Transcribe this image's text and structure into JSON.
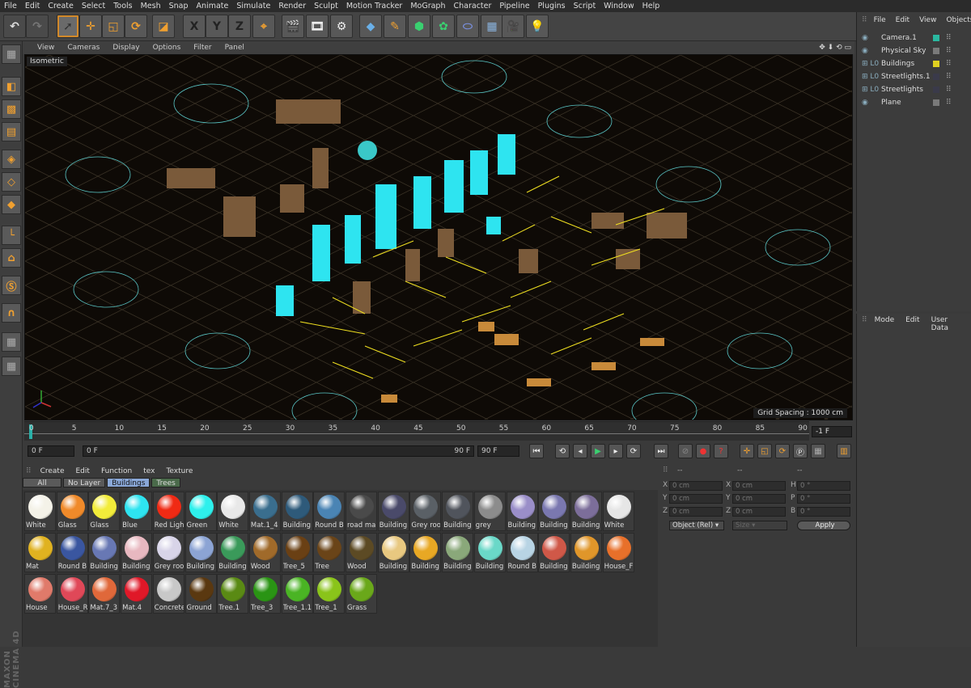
{
  "menu": [
    "File",
    "Edit",
    "Create",
    "Select",
    "Tools",
    "Mesh",
    "Snap",
    "Animate",
    "Simulate",
    "Render",
    "Sculpt",
    "Motion Tracker",
    "MoGraph",
    "Character",
    "Pipeline",
    "Plugins",
    "Script",
    "Window",
    "Help"
  ],
  "axis_buttons": [
    "X",
    "Y",
    "Z"
  ],
  "viewport": {
    "menu": [
      "View",
      "Cameras",
      "Display",
      "Options",
      "Filter",
      "Panel"
    ],
    "label": "Isometric",
    "grid_spacing": "Grid Spacing : 1000 cm"
  },
  "timeline": {
    "ticks": [
      "0",
      "5",
      "10",
      "15",
      "20",
      "25",
      "30",
      "35",
      "40",
      "45",
      "50",
      "55",
      "60",
      "65",
      "70",
      "75",
      "80",
      "85",
      "90"
    ],
    "current_frame": "-1 F",
    "start_field": "0 F",
    "range_start": "0 F",
    "range_end": "90 F",
    "end_field": "90 F"
  },
  "material_manager": {
    "menu": [
      "Create",
      "Edit",
      "Function",
      "tex",
      "Texture"
    ],
    "filters": [
      "All",
      "No Layer",
      "Buildings",
      "Trees"
    ],
    "active_filter": "Buildings",
    "materials": [
      {
        "name": "White",
        "color": "#f4f2e8"
      },
      {
        "name": "Glass",
        "color": "#f08a2a"
      },
      {
        "name": "Glass",
        "color": "#f2ec3a"
      },
      {
        "name": "Blue",
        "color": "#2ee4f0"
      },
      {
        "name": "Red Ligh",
        "color": "#f02a14"
      },
      {
        "name": "Green",
        "color": "#2ef0ec"
      },
      {
        "name": "White",
        "color": "#e8e8e8"
      },
      {
        "name": "Mat.1_4",
        "color": "#3a6e8e"
      },
      {
        "name": "Building",
        "color": "#2e5a7a"
      },
      {
        "name": "Round B",
        "color": "#4a84b4"
      },
      {
        "name": "road ma",
        "color": "#4a4a4a"
      },
      {
        "name": "Building",
        "color": "#4a4a6a"
      },
      {
        "name": "Grey roo",
        "color": "#5a6066"
      },
      {
        "name": "Building",
        "color": "#50545c"
      },
      {
        "name": "grey",
        "color": "#8c8c8c"
      },
      {
        "name": "Building",
        "color": "#9a8ec8"
      },
      {
        "name": "Building",
        "color": "#7a78b0"
      },
      {
        "name": "Building",
        "color": "#7c6e9a"
      },
      {
        "name": "White",
        "color": "#e6e6e6"
      },
      {
        "name": "Mat",
        "color": "#e0b220"
      },
      {
        "name": "Round B",
        "color": "#3a56a0"
      },
      {
        "name": "Building",
        "color": "#6878b4"
      },
      {
        "name": "Building",
        "color": "#e8b8c0"
      },
      {
        "name": "Grey roo",
        "color": "#d8d4e8"
      },
      {
        "name": "Building",
        "color": "#8ca4d4"
      },
      {
        "name": "Building",
        "color": "#3a9a5a"
      },
      {
        "name": "Wood",
        "color": "#a06a2a"
      },
      {
        "name": "Tree_5",
        "color": "#6a4014"
      },
      {
        "name": "Tree",
        "color": "#6a4418"
      },
      {
        "name": "Wood",
        "color": "#5c4a24"
      },
      {
        "name": "Building",
        "color": "#e8c880"
      },
      {
        "name": "Building",
        "color": "#e8a824"
      },
      {
        "name": "Building",
        "color": "#8aa87a"
      },
      {
        "name": "Building",
        "color": "#6ad8c8"
      },
      {
        "name": "Round B",
        "color": "#b8d4e4"
      },
      {
        "name": "Building",
        "color": "#d05848"
      },
      {
        "name": "Building",
        "color": "#e0962a"
      },
      {
        "name": "House_F",
        "color": "#e8702a"
      },
      {
        "name": "House",
        "color": "#e07a6a"
      },
      {
        "name": "House_R",
        "color": "#e04858"
      },
      {
        "name": "Mat.7_3",
        "color": "#e0683a"
      },
      {
        "name": "Mat.4",
        "color": "#e01828"
      },
      {
        "name": "Concrete",
        "color": "#c8c8c8"
      },
      {
        "name": "Ground",
        "color": "#5a3810"
      },
      {
        "name": "Tree.1",
        "color": "#5a8a14"
      },
      {
        "name": "Tree_3",
        "color": "#2a9414"
      },
      {
        "name": "Tree_1.1",
        "color": "#4ab424"
      },
      {
        "name": "Tree_1",
        "color": "#8ac41a"
      },
      {
        "name": "Grass",
        "color": "#6aa81a"
      }
    ]
  },
  "coordinates": {
    "headers": [
      "--",
      "--",
      "--"
    ],
    "rows": [
      {
        "axis": "X",
        "pos": "0 cm",
        "axis2": "X",
        "size": "0 cm",
        "rot_axis": "H",
        "rot": "0 °"
      },
      {
        "axis": "Y",
        "pos": "0 cm",
        "axis2": "Y",
        "size": "0 cm",
        "rot_axis": "P",
        "rot": "0 °"
      },
      {
        "axis": "Z",
        "pos": "0 cm",
        "axis2": "Z",
        "size": "0 cm",
        "rot_axis": "B",
        "rot": "0 °"
      }
    ],
    "mode_select": "Object (Rel)",
    "size_select": "Size",
    "apply_label": "Apply"
  },
  "object_manager": {
    "menu": [
      "File",
      "Edit",
      "View",
      "Objects"
    ],
    "objects": [
      {
        "name": "Camera.1",
        "tag_color": "#2ab8a0"
      },
      {
        "name": "Physical Sky",
        "tag_color": "#7a7a7a"
      },
      {
        "name": "Buildings",
        "tag_color": "#e0d020"
      },
      {
        "name": "Streetlights.1",
        "tag_color": "#3a3a4a"
      },
      {
        "name": "Streetlights",
        "tag_color": "#3a3a4a"
      },
      {
        "name": "Plane",
        "tag_color": "#7a7a7a"
      }
    ]
  },
  "attribute_manager": {
    "menu": [
      "Mode",
      "Edit",
      "User Data"
    ]
  },
  "branding": "MAXON CINEMA 4D"
}
